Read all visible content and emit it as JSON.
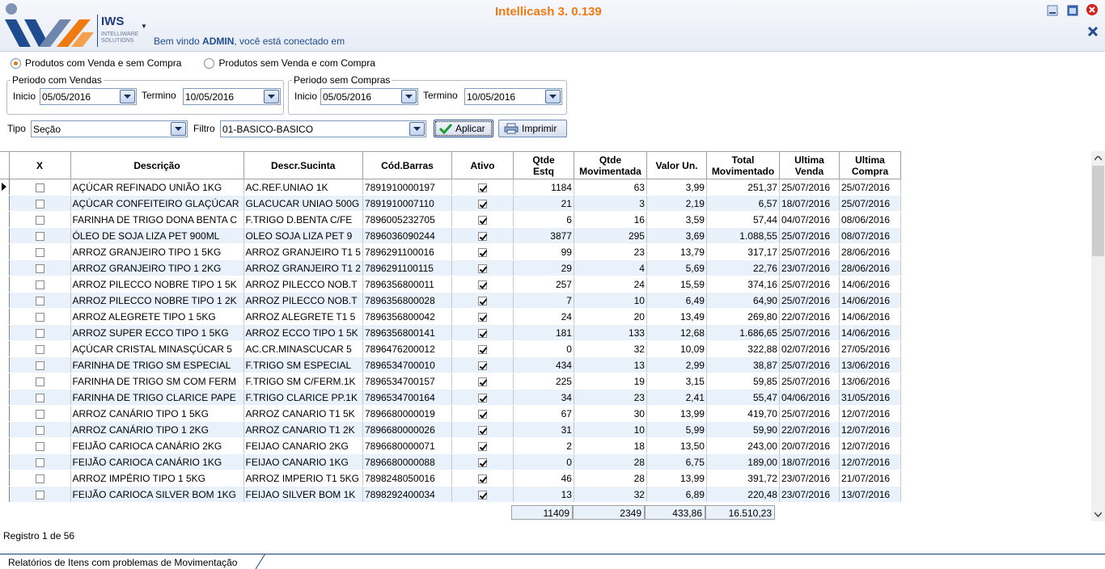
{
  "app": {
    "title": "Intellicash 3. 0.139",
    "logo_text": "IWS",
    "logo_sub": "INTELLIWARE SOLUTIONS",
    "welcome_prefix": "Bem vindo ",
    "welcome_user": "ADMIN",
    "welcome_suffix": ", você está conectado em"
  },
  "filters": {
    "radio1": "Produtos com Venda e sem Compra",
    "radio2": "Produtos sem Venda e com Compra",
    "group_vendas": "Periodo com Vendas",
    "group_compras": "Periodo sem Compras",
    "inicio_label": "Inicio",
    "termino_label": "Termino",
    "vendas_inicio": "05/05/2016",
    "vendas_termino": "10/05/2016",
    "compras_inicio": "05/05/2016",
    "compras_termino": "10/05/2016",
    "tipo_label": "Tipo",
    "tipo_value": "Seção",
    "filtro_label": "Filtro",
    "filtro_value": "01-BASICO-BASICO",
    "apply_label": "Aplicar",
    "print_label": "Imprimir"
  },
  "grid": {
    "headers": {
      "x": "X",
      "descricao": "Descrição",
      "sucinta": "Descr.Sucinta",
      "barras": "Cód.Barras",
      "ativo": "Ativo",
      "qtde_estq_1": "Qtde",
      "qtde_estq_2": "Estq",
      "qtde_mov_1": "Qtde",
      "qtde_mov_2": "Movimentada",
      "valor_un": "Valor Un.",
      "total_mov_1": "Total",
      "total_mov_2": "Movimentado",
      "ult_venda_1": "Ultima",
      "ult_venda_2": "Venda",
      "ult_compra_1": "Ultima",
      "ult_compra_2": "Compra"
    },
    "rows": [
      {
        "desc": "AÇÚCAR REFINADO UNIÃO 1KG",
        "suc": "AC.REF.UNIAO 1K",
        "bar": "7891910000197",
        "ativo": true,
        "estq": "1184",
        "mov": "63",
        "vun": "3,99",
        "tot": "251,37",
        "uv": "25/07/2016",
        "uc": "25/07/2016"
      },
      {
        "desc": "AÇÚCAR CONFEITEIRO GLAÇÚCAR",
        "suc": "GLACUCAR UNIAO 500G",
        "bar": "7891910007110",
        "ativo": true,
        "estq": "21",
        "mov": "3",
        "vun": "2,19",
        "tot": "6,57",
        "uv": "18/07/2016",
        "uc": "25/07/2016"
      },
      {
        "desc": "FARINHA DE TRIGO DONA BENTA C",
        "suc": "F.TRIGO D.BENTA C/FE",
        "bar": "7896005232705",
        "ativo": true,
        "estq": "6",
        "mov": "16",
        "vun": "3,59",
        "tot": "57,44",
        "uv": "04/07/2016",
        "uc": "08/06/2016"
      },
      {
        "desc": "ÓLEO DE SOJA LIZA PET 900ML",
        "suc": "OLEO SOJA LIZA PET 9",
        "bar": "7896036090244",
        "ativo": true,
        "estq": "3877",
        "mov": "295",
        "vun": "3,69",
        "tot": "1.088,55",
        "uv": "25/07/2016",
        "uc": "08/07/2016"
      },
      {
        "desc": "ARROZ GRANJEIRO TIPO 1 5KG",
        "suc": "ARROZ GRANJEIRO T1 5",
        "bar": "7896291100016",
        "ativo": true,
        "estq": "99",
        "mov": "23",
        "vun": "13,79",
        "tot": "317,17",
        "uv": "25/07/2016",
        "uc": "28/06/2016"
      },
      {
        "desc": "ARROZ GRANJEIRO TIPO 1 2KG",
        "suc": "ARROZ GRANJEIRO T1 2",
        "bar": "7896291100115",
        "ativo": true,
        "estq": "29",
        "mov": "4",
        "vun": "5,69",
        "tot": "22,76",
        "uv": "23/07/2016",
        "uc": "28/06/2016"
      },
      {
        "desc": "ARROZ PILECCO NOBRE TIPO 1 5K",
        "suc": "ARROZ PILECCO NOB.T",
        "bar": "7896356800011",
        "ativo": true,
        "estq": "257",
        "mov": "24",
        "vun": "15,59",
        "tot": "374,16",
        "uv": "25/07/2016",
        "uc": "14/06/2016"
      },
      {
        "desc": "ARROZ PILECCO NOBRE TIPO 1 2K",
        "suc": "ARROZ PILECCO NOB.T",
        "bar": "7896356800028",
        "ativo": true,
        "estq": "7",
        "mov": "10",
        "vun": "6,49",
        "tot": "64,90",
        "uv": "25/07/2016",
        "uc": "14/06/2016"
      },
      {
        "desc": "ARROZ ALEGRETE TIPO 1 5KG",
        "suc": "ARROZ ALEGRETE T1 5",
        "bar": "7896356800042",
        "ativo": true,
        "estq": "24",
        "mov": "20",
        "vun": "13,49",
        "tot": "269,80",
        "uv": "22/07/2016",
        "uc": "14/06/2016"
      },
      {
        "desc": "ARROZ SUPER ECCO TIPO 1 5KG",
        "suc": "ARROZ ECCO TIPO 1 5K",
        "bar": "7896356800141",
        "ativo": true,
        "estq": "181",
        "mov": "133",
        "vun": "12,68",
        "tot": "1.686,65",
        "uv": "25/07/2016",
        "uc": "14/06/2016"
      },
      {
        "desc": "AÇÚCAR CRISTAL MINASÇÚCAR 5",
        "suc": "AC.CR.MINASCUCAR 5",
        "bar": "7896476200012",
        "ativo": true,
        "estq": "0",
        "mov": "32",
        "vun": "10,09",
        "tot": "322,88",
        "uv": "02/07/2016",
        "uc": "27/05/2016"
      },
      {
        "desc": "FARINHA DE TRIGO SM ESPECIAL",
        "suc": "F.TRIGO SM ESPECIAL",
        "bar": "7896534700010",
        "ativo": true,
        "estq": "434",
        "mov": "13",
        "vun": "2,99",
        "tot": "38,87",
        "uv": "25/07/2016",
        "uc": "13/06/2016"
      },
      {
        "desc": "FARINHA DE TRIGO SM COM FERM",
        "suc": "F.TRIGO SM C/FERM.1K",
        "bar": "7896534700157",
        "ativo": true,
        "estq": "225",
        "mov": "19",
        "vun": "3,15",
        "tot": "59,85",
        "uv": "25/07/2016",
        "uc": "13/06/2016"
      },
      {
        "desc": "FARINHA DE TRIGO CLARICE PAPE",
        "suc": "F.TRIGO CLARICE PP.1K",
        "bar": "7896534700164",
        "ativo": true,
        "estq": "34",
        "mov": "23",
        "vun": "2,41",
        "tot": "55,47",
        "uv": "04/06/2016",
        "uc": "31/05/2016"
      },
      {
        "desc": "ARROZ CANÁRIO TIPO 1 5KG",
        "suc": "ARROZ CANARIO T1 5K",
        "bar": "7896680000019",
        "ativo": true,
        "estq": "67",
        "mov": "30",
        "vun": "13,99",
        "tot": "419,70",
        "uv": "25/07/2016",
        "uc": "12/07/2016"
      },
      {
        "desc": "ARROZ CANÁRIO TIPO 1 2KG",
        "suc": "ARROZ CANARIO T1 2K",
        "bar": "7896680000026",
        "ativo": true,
        "estq": "31",
        "mov": "10",
        "vun": "5,99",
        "tot": "59,90",
        "uv": "22/07/2016",
        "uc": "12/07/2016"
      },
      {
        "desc": "FEIJÃO CARIOCA CANÁRIO 2KG",
        "suc": "FEIJAO CANARIO 2KG",
        "bar": "7896680000071",
        "ativo": true,
        "estq": "2",
        "mov": "18",
        "vun": "13,50",
        "tot": "243,00",
        "uv": "20/07/2016",
        "uc": "12/07/2016"
      },
      {
        "desc": "FEIJÃO CARIOCA CANÁRIO 1KG",
        "suc": "FEIJAO CANARIO 1KG",
        "bar": "7896680000088",
        "ativo": true,
        "estq": "0",
        "mov": "28",
        "vun": "6,75",
        "tot": "189,00",
        "uv": "18/07/2016",
        "uc": "12/07/2016"
      },
      {
        "desc": "ARROZ IMPÉRIO TIPO 1 5KG",
        "suc": "ARROZ IMPERIO T1 5KG",
        "bar": "7898248050016",
        "ativo": true,
        "estq": "46",
        "mov": "28",
        "vun": "13,99",
        "tot": "391,72",
        "uv": "23/07/2016",
        "uc": "21/07/2016"
      },
      {
        "desc": "FEIJÃO CARIOCA SILVER BOM 1KG",
        "suc": "FEIJAO SILVER BOM 1K",
        "bar": "7898292400034",
        "ativo": true,
        "estq": "13",
        "mov": "32",
        "vun": "6,89",
        "tot": "220,48",
        "uv": "23/07/2016",
        "uc": "13/07/2016"
      }
    ],
    "totals": {
      "estq": "11409",
      "mov": "2349",
      "vun": "433,86",
      "tot": "16.510,23"
    }
  },
  "status": {
    "record": "Registro 1 de 56"
  },
  "tabs": {
    "active": "Relatórios de Itens com problemas de Movimentação"
  },
  "colors": {
    "title_orange": "#f07a10",
    "welcome_blue": "#1f4c8f",
    "row_alt": "#e9f2fb",
    "tab_border": "#18427f"
  }
}
